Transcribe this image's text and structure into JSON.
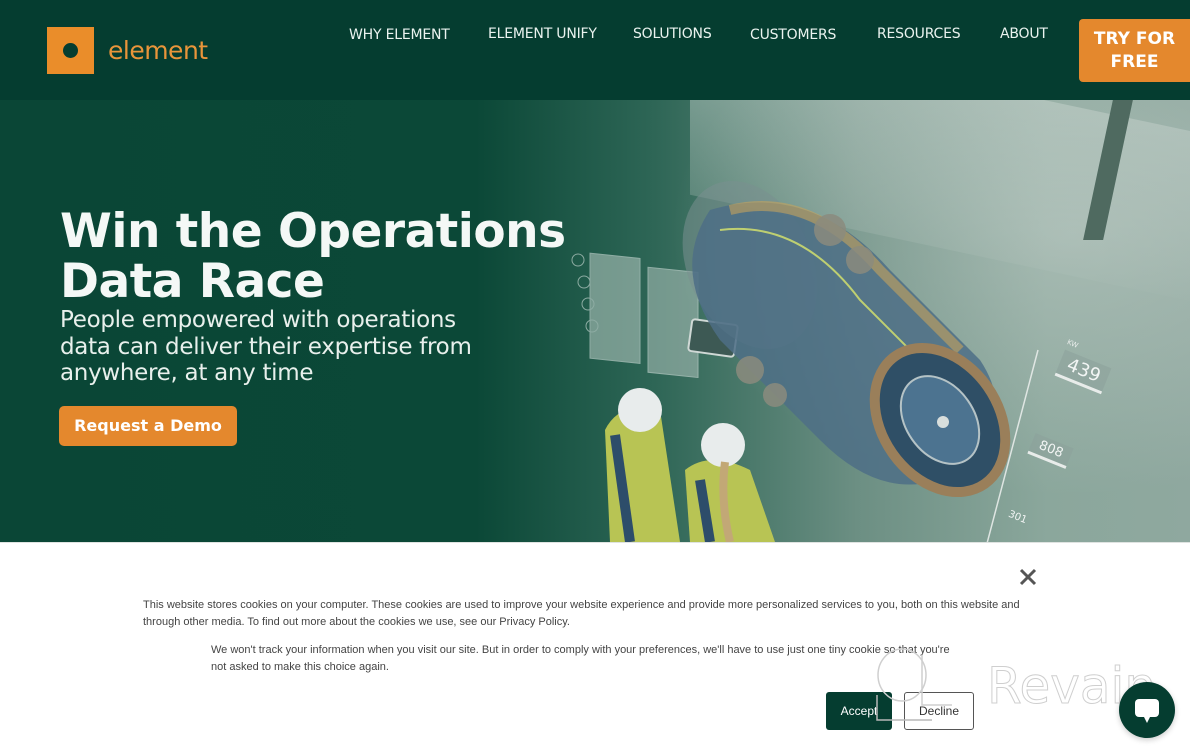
{
  "brand": {
    "name": "element",
    "primary_color": "#053d30",
    "accent_color": "#e4882d"
  },
  "nav": {
    "items": [
      {
        "label": "WHY ELEMENT"
      },
      {
        "label": "ELEMENT UNIFY"
      },
      {
        "label": "SOLUTIONS"
      },
      {
        "label": "CUSTOMERS"
      },
      {
        "label": "RESOURCES"
      },
      {
        "label": "ABOUT"
      }
    ],
    "cta_line1": "TRY FOR",
    "cta_line2": "FREE"
  },
  "hero": {
    "title_line1": "Win the Operations",
    "title_line2": "Data Race",
    "subtitle_line1": "People empowered with operations",
    "subtitle_line2": "data can deliver their expertise from",
    "subtitle_line3": "anywhere, at any time",
    "cta_label": "Request a Demo",
    "hud": {
      "unit": "KW",
      "readings": [
        "439",
        "808",
        "301"
      ]
    }
  },
  "cookie_banner": {
    "text_line1": "This website stores cookies on your computer. These cookies are used to improve your website experience and provide more personalized services to you, both on this website and",
    "text_line2": "through other media. To find out more about the cookies we use, see our Privacy Policy.",
    "text2_line1": "We won't track your information when you visit our site. But in order to comply with your preferences, we'll have to use just one tiny cookie so that you're",
    "text2_line2": "not asked to make this choice again.",
    "accept_label": "Accept",
    "decline_label": "Decline",
    "close_icon": "close-icon"
  },
  "chat": {
    "icon": "chat-bubble-icon"
  },
  "watermark": {
    "text": "Revain"
  }
}
